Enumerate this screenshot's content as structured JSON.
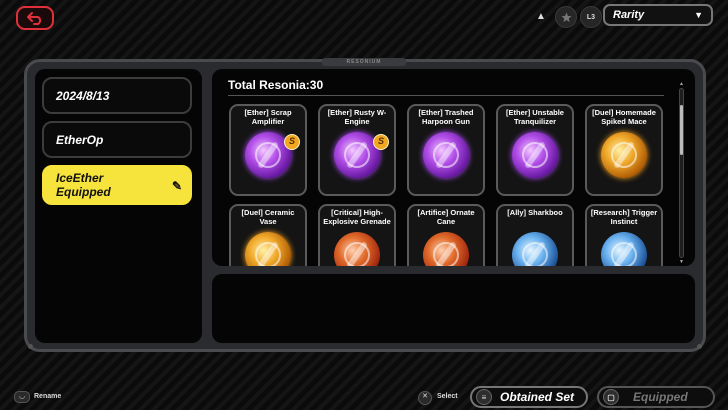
{
  "header": {
    "triangle_label": "▲",
    "l3_label": "L3",
    "rarity_label": "Rarity"
  },
  "sidebar": {
    "items": [
      {
        "label": "2024/8/13"
      },
      {
        "label": "EtherOp"
      },
      {
        "label": "IceEther Equipped"
      }
    ]
  },
  "panel": {
    "tab_label": "RESONIUM"
  },
  "collection": {
    "total_label": "Total Resonia:30",
    "cards": [
      {
        "name": "[Ether] Scrap Amplifier",
        "rank": "S",
        "style": "ether"
      },
      {
        "name": "[Ether] Rusty W-Engine",
        "rank": "S",
        "style": "ether"
      },
      {
        "name": "[Ether] Trashed Harpoon Gun",
        "rank": "",
        "style": "ether"
      },
      {
        "name": "[Ether] Unstable Tranquilizer",
        "rank": "",
        "style": "ether"
      },
      {
        "name": "[Duel] Homemade Spiked Mace",
        "rank": "",
        "style": "gold"
      },
      {
        "name": "[Duel] Ceramic Vase",
        "rank": "",
        "style": "gold"
      },
      {
        "name": "[Critical] High-Explosive Grenade",
        "rank": "",
        "style": "red"
      },
      {
        "name": "[Artifice] Ornate Cane",
        "rank": "",
        "style": "red"
      },
      {
        "name": "[Ally] Sharkboo",
        "rank": "",
        "style": "blue"
      },
      {
        "name": "[Research] Trigger Instinct",
        "rank": "",
        "style": "blue"
      }
    ]
  },
  "footer": {
    "rename_label": "Rename",
    "select_label": "Select",
    "obtained_set_label": "Obtained Set",
    "equipped_label": "Equipped"
  }
}
